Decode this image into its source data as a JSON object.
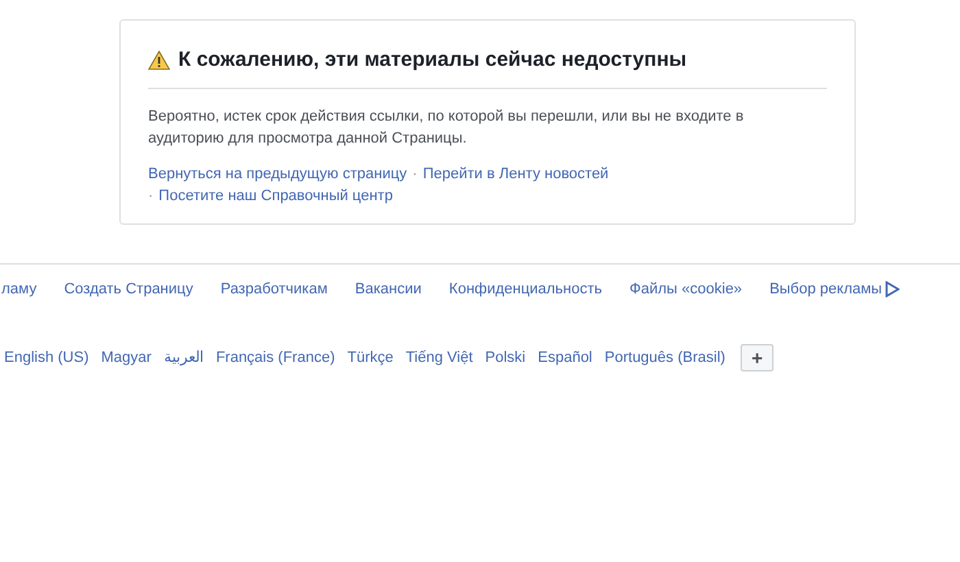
{
  "notice": {
    "title": "К сожалению, эти материалы сейчас недоступны",
    "message": "Вероятно, истек срок действия ссылки, по которой вы перешли, или вы не входите в аудиторию для просмотра данной Страницы.",
    "links": [
      "Вернуться на предыдущую страницу",
      "Перейти в Ленту новостей",
      "Посетите наш Справочный центр"
    ],
    "separator": "·"
  },
  "footer_links": [
    "ламу",
    "Создать Страницу",
    "Разработчикам",
    "Вакансии",
    "Конфиденциальность",
    "Файлы «cookie»",
    "Выбор рекламы"
  ],
  "languages": [
    "English (US)",
    "Magyar",
    "العربية",
    "Français (France)",
    "Türkçe",
    "Tiếng Việt",
    "Polski",
    "Español",
    "Português (Brasil)"
  ],
  "more_languages": {
    "label": "+"
  }
}
